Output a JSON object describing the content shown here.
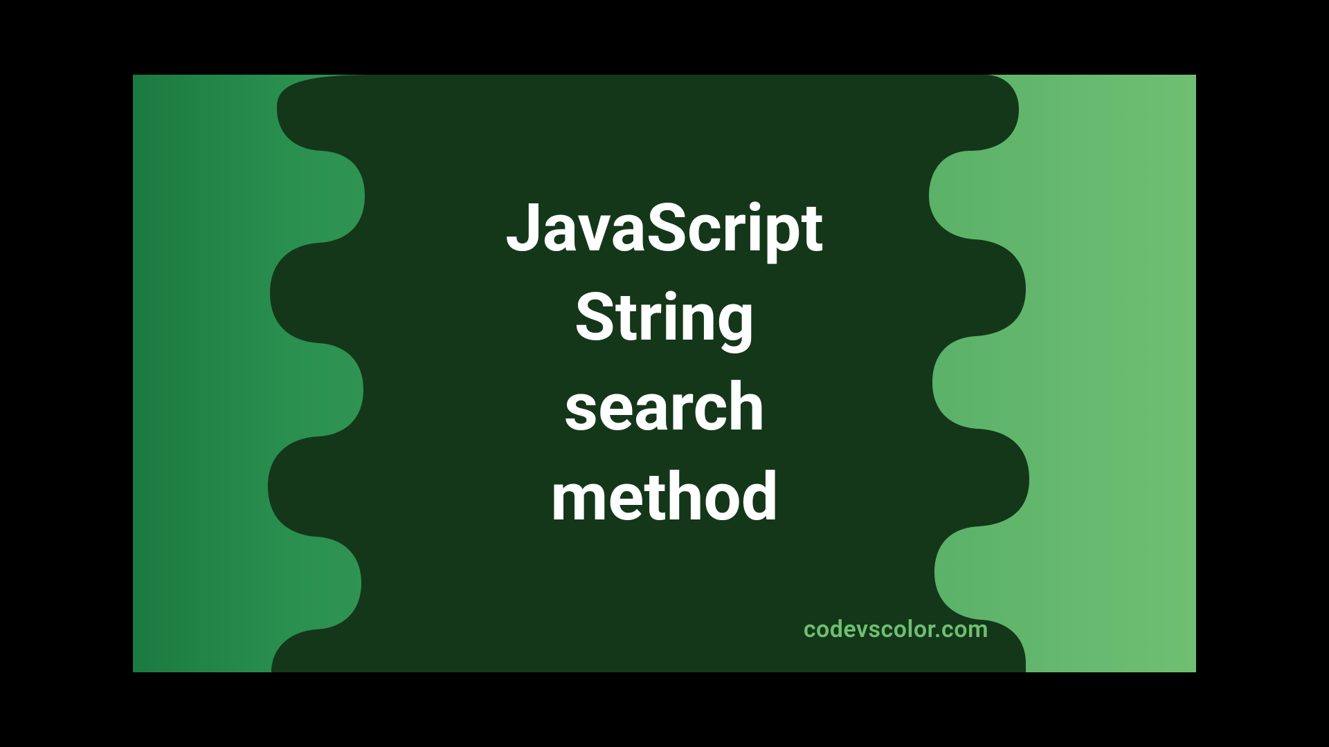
{
  "title_lines": [
    "JavaScript",
    "String",
    "search",
    "method"
  ],
  "brand": "codevscolor.com",
  "colors": {
    "blob": "#143719",
    "text": "#ffffff",
    "brand": "#6fbf73"
  }
}
